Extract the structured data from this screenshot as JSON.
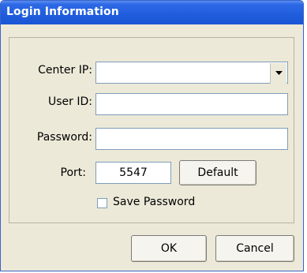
{
  "window": {
    "title": "Login Information"
  },
  "form": {
    "center_ip": {
      "label": "Center IP:",
      "value": ""
    },
    "user_id": {
      "label": "User ID:",
      "value": ""
    },
    "password": {
      "label": "Password:",
      "value": ""
    },
    "port": {
      "label": "Port:",
      "value": "5547"
    },
    "default_button": "Default",
    "save_password": {
      "label": "Save Password",
      "checked": false
    }
  },
  "buttons": {
    "ok": "OK",
    "cancel": "Cancel"
  },
  "icons": {
    "dropdown": "chevron-down-icon"
  }
}
